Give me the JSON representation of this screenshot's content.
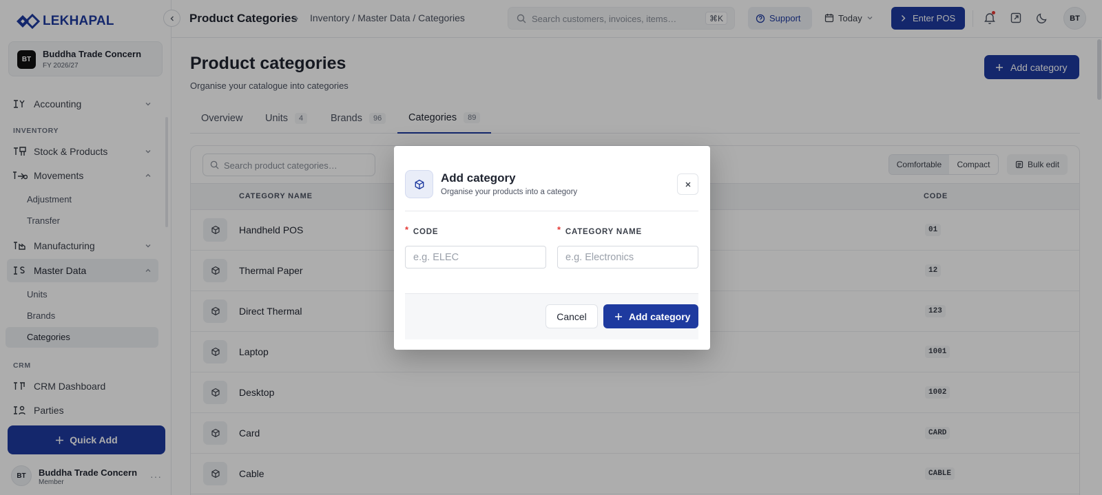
{
  "brand": {
    "name": "LEKHAPAL",
    "color": "#1e3a9f"
  },
  "org": {
    "initials": "BT",
    "name": "Buddha Trade Concern",
    "fiscal_year": "FY 2026/27"
  },
  "sidebar": {
    "accounting": {
      "label": "Accounting",
      "icon": "ledger-icon"
    },
    "inventory_section": "INVENTORY",
    "stock": {
      "label": "Stock & Products",
      "icon": "boxes-icon"
    },
    "movements": {
      "label": "Movements",
      "icon": "truck-icon",
      "children": [
        "Adjustment",
        "Transfer"
      ]
    },
    "manufacturing": {
      "label": "Manufacturing",
      "icon": "factory-icon"
    },
    "master_data": {
      "label": "Master Data",
      "icon": "database-icon",
      "children": [
        "Units",
        "Brands",
        "Categories"
      ],
      "active_child": "Categories"
    },
    "crm_section": "CRM",
    "crm_dashboard": {
      "label": "CRM Dashboard",
      "icon": "chart-icon"
    },
    "parties": {
      "label": "Parties",
      "icon": "users-icon"
    },
    "quick_add": "Quick Add",
    "user": {
      "initials": "BT",
      "name": "Buddha Trade Concern",
      "role": "Member"
    }
  },
  "topbar": {
    "page_title": "Product Categories",
    "breadcrumb": "Inventory / Master Data / Categories",
    "search_placeholder": "Search customers, invoices, items…",
    "search_shortcut": "⌘K",
    "support": "Support",
    "date_filter": "Today",
    "enter_pos": "Enter POS",
    "avatar_initials": "BT"
  },
  "main": {
    "title": "Product categories",
    "subtitle": "Organise your catalogue into categories",
    "add_button": "Add category",
    "tabs": [
      {
        "label": "Overview",
        "count": ""
      },
      {
        "label": "Units",
        "count": "4"
      },
      {
        "label": "Brands",
        "count": "96"
      },
      {
        "label": "Categories",
        "count": "89"
      }
    ],
    "active_tab": "Categories",
    "table": {
      "search_placeholder": "Search product categories…",
      "density": [
        "Comfortable",
        "Compact"
      ],
      "density_selected": "Comfortable",
      "bulk_edit": "Bulk edit",
      "columns": [
        "CATEGORY NAME",
        "CODE"
      ],
      "rows": [
        {
          "name": "Handheld POS",
          "code": "01"
        },
        {
          "name": "Thermal Paper",
          "code": "12"
        },
        {
          "name": "Direct Thermal",
          "code": "123"
        },
        {
          "name": "Laptop",
          "code": "1001"
        },
        {
          "name": "Desktop",
          "code": "1002"
        },
        {
          "name": "Card",
          "code": "CARD"
        },
        {
          "name": "Cable",
          "code": "CABLE"
        }
      ]
    }
  },
  "modal": {
    "title": "Add category",
    "subtitle": "Organise your products into a category",
    "code_label": "CODE",
    "code_placeholder": "e.g. ELEC",
    "code_value": "",
    "name_label": "CATEGORY NAME",
    "name_placeholder": "e.g. Electronics",
    "name_value": "",
    "required_mark": "*",
    "cancel": "Cancel",
    "submit": "Add category"
  }
}
